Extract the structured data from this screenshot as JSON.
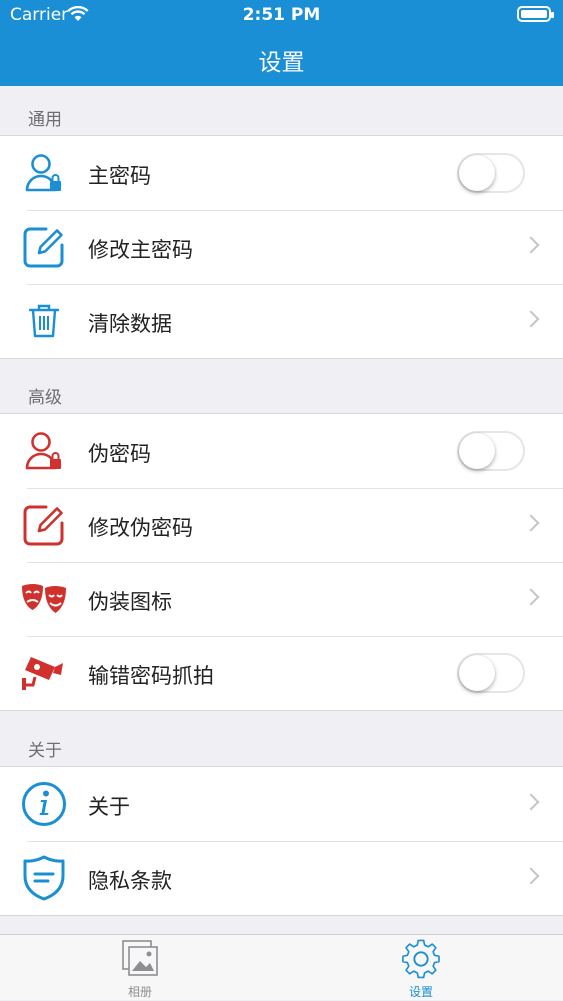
{
  "status_bar": {
    "carrier": "Carrier",
    "time": "2:51 PM"
  },
  "nav": {
    "title": "设置"
  },
  "sections": [
    {
      "header": "通用",
      "items": [
        {
          "label": "主密码",
          "icon": "user-lock-icon",
          "accessory": "toggle",
          "on": false
        },
        {
          "label": "修改主密码",
          "icon": "edit-icon",
          "accessory": "chevron"
        },
        {
          "label": "清除数据",
          "icon": "trash-icon",
          "accessory": "chevron"
        }
      ]
    },
    {
      "header": "高级",
      "items": [
        {
          "label": "伪密码",
          "icon": "user-lock-icon",
          "accessory": "toggle",
          "on": false
        },
        {
          "label": "修改伪密码",
          "icon": "edit-icon",
          "accessory": "chevron"
        },
        {
          "label": "伪装图标",
          "icon": "theater-masks-icon",
          "accessory": "chevron"
        },
        {
          "label": "输错密码抓拍",
          "icon": "security-camera-icon",
          "accessory": "toggle",
          "on": false
        }
      ]
    },
    {
      "header": "关于",
      "items": [
        {
          "label": "关于",
          "icon": "info-icon",
          "accessory": "chevron"
        },
        {
          "label": "隐私条款",
          "icon": "shield-icon",
          "accessory": "chevron"
        }
      ]
    }
  ],
  "tabs": [
    {
      "label": "相册",
      "icon": "photo-album-icon",
      "selected": false
    },
    {
      "label": "设置",
      "icon": "gear-icon",
      "selected": true
    }
  ],
  "colors": {
    "accent": "#1a8fd6",
    "danger": "#d0312d",
    "tab_inactive": "#8e8e93"
  }
}
